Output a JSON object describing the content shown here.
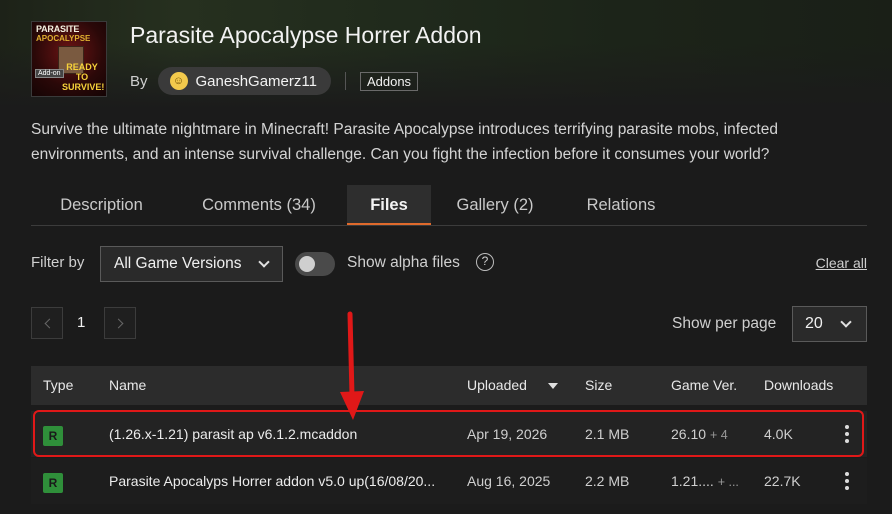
{
  "addon": {
    "title": "Parasite Apocalypse Horrer Addon",
    "by_label": "By",
    "author": "GaneshGamerz11",
    "tag": "Addons",
    "logo_text": {
      "title": "PARASITE",
      "subtitle": "APOCALYPSE",
      "badge": "Add-on",
      "ready": "READY TO SURVIVE!"
    }
  },
  "description": "Survive the ultimate nightmare in Minecraft! Parasite Apocalypse introduces terrifying parasite mobs, infected environments, and an intense survival challenge. Can you fight the infection before it consumes your world?",
  "tabs": [
    {
      "label": "Description"
    },
    {
      "label": "Comments (34)"
    },
    {
      "label": "Files"
    },
    {
      "label": "Gallery (2)"
    },
    {
      "label": "Relations"
    }
  ],
  "active_tab": "Files",
  "filters": {
    "filter_by_label": "Filter by",
    "game_version": "All Game Versions",
    "alpha_label": "Show alpha files",
    "alpha_enabled": false,
    "help_glyph": "?",
    "clear_all": "Clear all"
  },
  "pagination": {
    "current_page": "1",
    "per_page_label": "Show per page",
    "per_page": "20"
  },
  "table": {
    "headers": {
      "type": "Type",
      "name": "Name",
      "uploaded": "Uploaded",
      "size": "Size",
      "game_ver": "Game Ver.",
      "downloads": "Downloads"
    },
    "rows": [
      {
        "type": "R",
        "name": "(1.26.x-1.21) parasit ap v6.1.2.mcaddon",
        "uploaded": "Apr 19, 2026",
        "size": "2.1 MB",
        "game_ver": "26.10",
        "game_ver_more": "+ 4",
        "downloads": "4.0K"
      },
      {
        "type": "R",
        "name": "Parasite Apocalyps Horrer addon v5.0 up(16/08/20...",
        "uploaded": "Aug 16, 2025",
        "size": "2.2 MB",
        "game_ver": "1.21....",
        "game_ver_more": "+ ...",
        "downloads": "22.7K"
      }
    ]
  },
  "colors": {
    "background": "#1b1b1b",
    "accent_tab": "#e06a2c",
    "release_badge": "#2f8f3a",
    "annotation_red": "#e01818"
  },
  "annotation": {
    "arrow_icon": "red-down-arrow",
    "highlighted_row": 0
  }
}
